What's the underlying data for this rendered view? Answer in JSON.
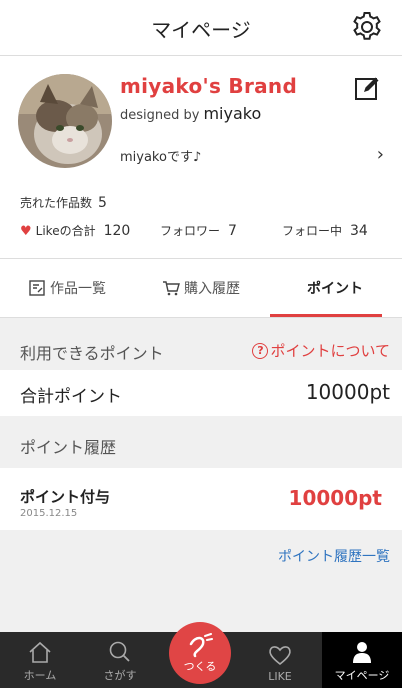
{
  "header": {
    "title": "マイページ",
    "settings_icon": "gear-icon"
  },
  "profile": {
    "brand": "miyako's Brand",
    "designed_prefix": "designed by",
    "designer": "miyako",
    "intro": "miyakoです♪",
    "sold_label": "売れた作品数",
    "sold_count": "5",
    "like_label": "Likeの合計",
    "like_count": "120",
    "follower_label": "フォロワー",
    "follower_count": "7",
    "following_label": "フォロー中",
    "following_count": "34"
  },
  "tabs": [
    {
      "label": "作品一覧",
      "icon": "works-icon"
    },
    {
      "label": "購入履歴",
      "icon": "cart-icon"
    },
    {
      "label": "ポイント",
      "active": true
    }
  ],
  "points": {
    "available_header": "利用できるポイント",
    "about_link": "ポイントについて",
    "total_label": "合計ポイント",
    "total_value": "10000pt",
    "history_header": "ポイント履歴",
    "history": [
      {
        "title": "ポイント付与",
        "date": "2015.12.15",
        "value": "10000pt"
      }
    ],
    "history_link": "ポイント履歴一覧"
  },
  "bottom_nav": {
    "home": "ホーム",
    "search": "さがす",
    "make": "つくる",
    "like": "LIKE",
    "mypage": "マイページ"
  },
  "colors": {
    "accent": "#e04040",
    "link": "#2f74c0",
    "nav_bg": "#2a2a2a"
  }
}
